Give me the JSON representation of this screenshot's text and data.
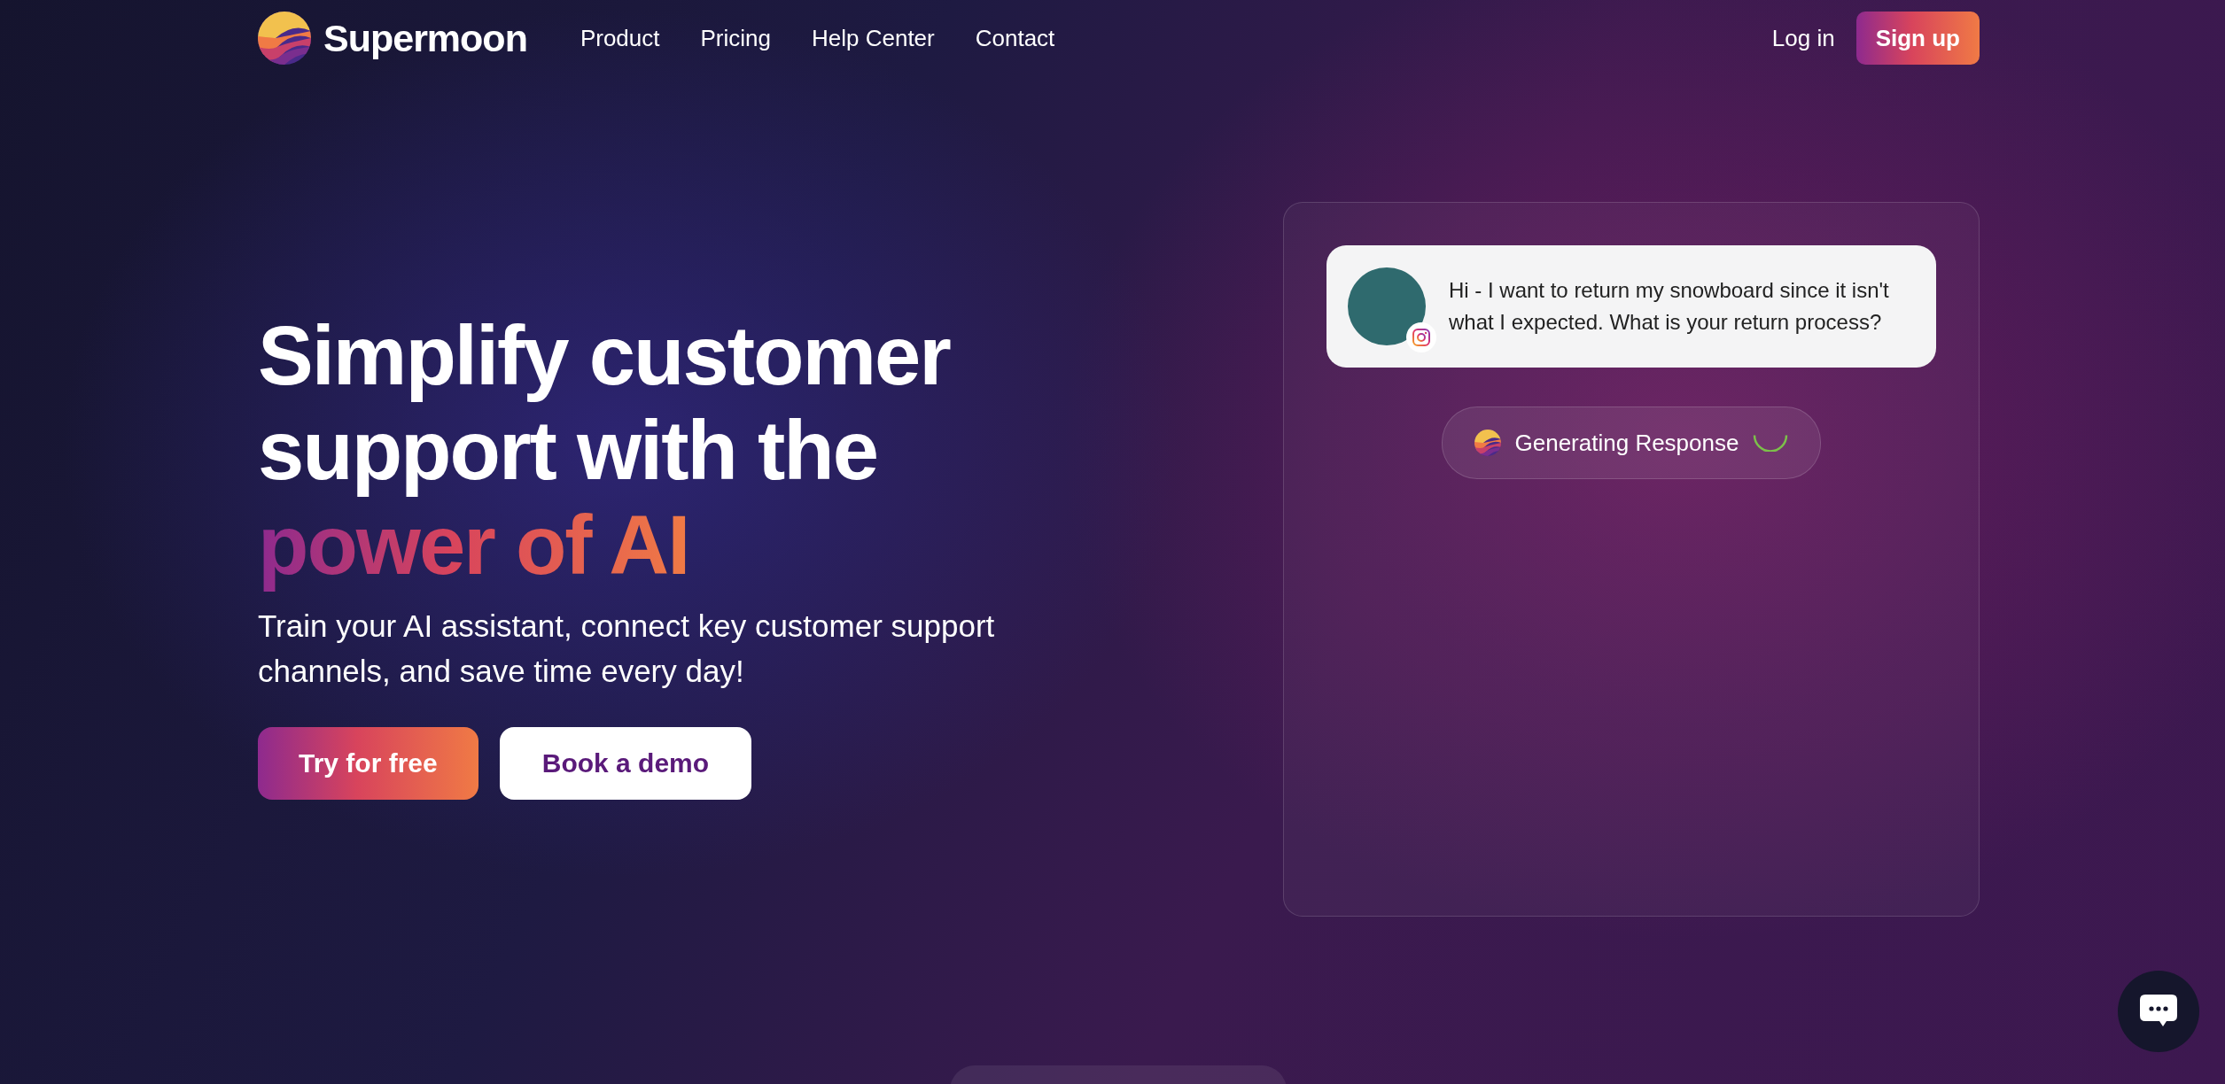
{
  "header": {
    "brand": "Supermoon",
    "nav": [
      {
        "label": "Product"
      },
      {
        "label": "Pricing"
      },
      {
        "label": "Help Center"
      },
      {
        "label": "Contact"
      }
    ],
    "login": "Log in",
    "signup": "Sign up"
  },
  "hero": {
    "heading_lines": [
      "Simplify customer",
      "support with the"
    ],
    "heading_highlight": "power of AI",
    "subtitle": "Train your AI assistant, connect key customer support channels, and save time every day!",
    "buttons": [
      {
        "label": "Try for free",
        "kind": "primary"
      },
      {
        "label": "Book a demo",
        "kind": "secondary"
      }
    ]
  },
  "chat_card": {
    "message": {
      "text": "Hi - I want to return my snowboard since it isn't what I expected. What is your return process?"
    },
    "status": "Generating Response"
  }
}
